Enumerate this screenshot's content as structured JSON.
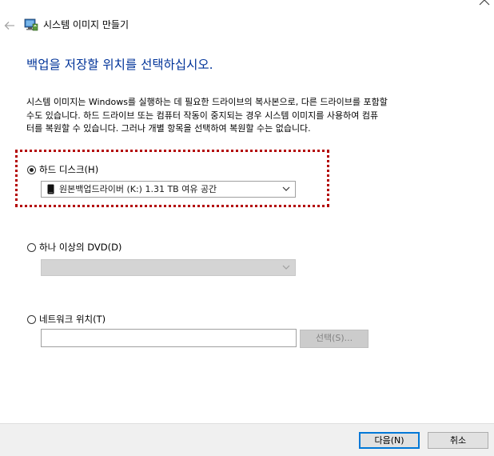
{
  "window": {
    "title": "시스템 이미지 만들기"
  },
  "page": {
    "heading": "백업을 저장할 위치를 선택하십시오.",
    "description_lines": [
      "시스템 이미지는 Windows를 실행하는 데 필요한 드라이브의 복사본으로, 다른 드라이브를 포함할",
      "수도 있습니다. 하드 드라이브 또는 컴퓨터 작동이 중지되는 경우 시스템 이미지를 사용하여 컴퓨",
      "터를 복원할 수 있습니다. 그러나 개별 항목을 선택하여 복원할 수는 없습니다."
    ]
  },
  "options": {
    "hard_disk": {
      "label": "하드 디스크(H)",
      "selected": true,
      "dropdown_value": "원본백업드라이버 (K:)  1.31 TB 여유 공간"
    },
    "dvd": {
      "label": "하나 이상의 DVD(D)",
      "selected": false,
      "dropdown_value": ""
    },
    "network": {
      "label": "네트워크 위치(T)",
      "selected": false,
      "input_value": "",
      "select_button_label": "선택(S)..."
    }
  },
  "footer": {
    "next_label": "다음(N)",
    "cancel_label": "취소"
  },
  "icons": {
    "back": "back-arrow-icon",
    "app": "backup-computer-icon",
    "close": "close-icon",
    "drive": "hard-drive-icon",
    "dropdown": "chevron-down-icon"
  },
  "colors": {
    "heading": "#003399",
    "highlight_border": "#b30000",
    "default_button_border": "#0078d7",
    "footer_bg": "#f0f0f0"
  }
}
